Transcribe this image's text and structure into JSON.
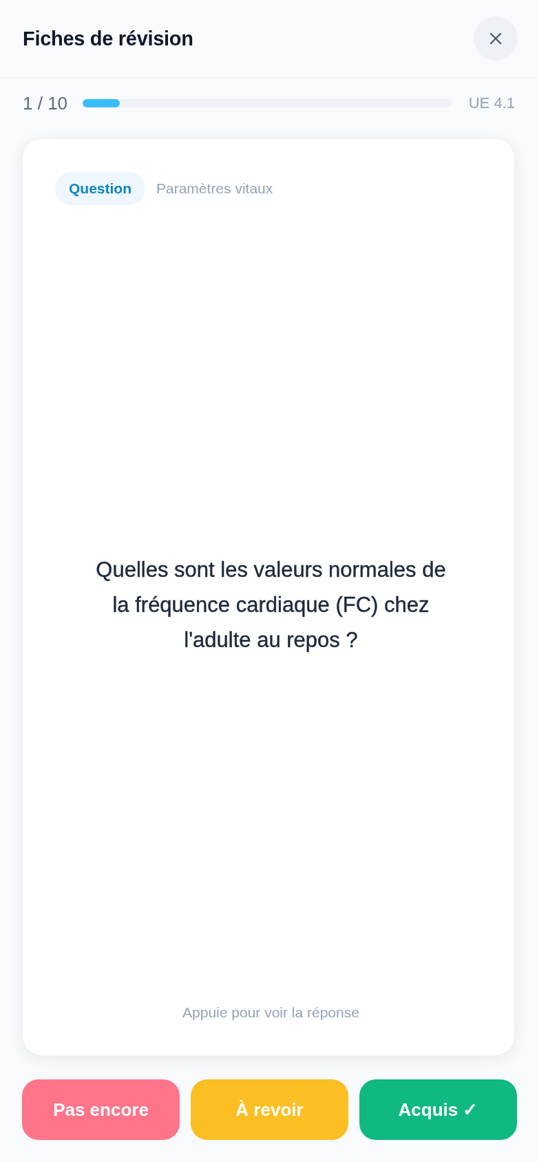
{
  "header": {
    "title": "Fiches de révision"
  },
  "progress": {
    "counter": "1 / 10",
    "level": 0.1,
    "unit": "UE 4.1"
  },
  "card": {
    "face_label": "Question",
    "topic": "Paramètres vitaux",
    "question": "Quelles sont les valeurs normales de la fréquence cardiaque (FC) chez l'adulte au repos ?",
    "hint": "Appuie pour voir la réponse"
  },
  "buttons": [
    {
      "label": "Pas encore",
      "color": "#ff7489"
    },
    {
      "label": "À revoir",
      "color": "#fbbf24"
    },
    {
      "label": "Acquis ✓",
      "color": "#10b981"
    }
  ]
}
